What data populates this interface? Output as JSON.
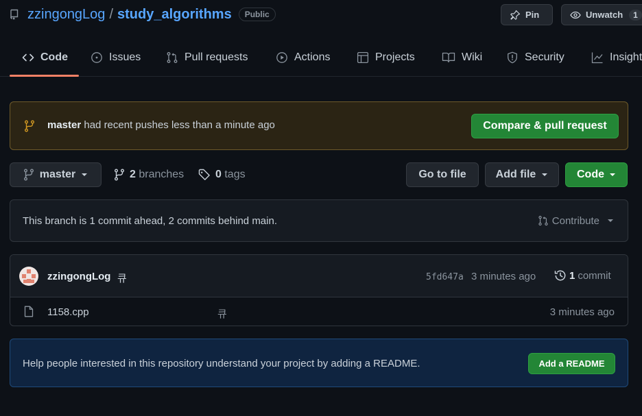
{
  "header": {
    "owner": "zzingongLog",
    "separator": "/",
    "repo_name": "study_algorithms",
    "visibility": "Public",
    "pin_label": "Pin",
    "watch_label": "Unwatch",
    "watch_count": "1"
  },
  "tabs": [
    {
      "label": "Code",
      "icon": "code-icon",
      "selected": true
    },
    {
      "label": "Issues",
      "icon": "issue-icon"
    },
    {
      "label": "Pull requests",
      "icon": "pull-request-icon"
    },
    {
      "label": "Actions",
      "icon": "play-icon"
    },
    {
      "label": "Projects",
      "icon": "table-icon"
    },
    {
      "label": "Wiki",
      "icon": "book-icon"
    },
    {
      "label": "Security",
      "icon": "shield-icon"
    },
    {
      "label": "Insights",
      "icon": "graph-icon"
    }
  ],
  "push_banner": {
    "branch": "master",
    "message": " had recent pushes less than a minute ago",
    "button_label": "Compare & pull request"
  },
  "branch_bar": {
    "current_branch": "master",
    "branches_count": "2",
    "branches_label": "branches",
    "tags_count": "0",
    "tags_label": "tags",
    "go_to_file": "Go to file",
    "add_file": "Add file",
    "code_button": "Code"
  },
  "branch_status": {
    "text": "This branch is 1 commit ahead, 2 commits behind main.",
    "contribute_label": "Contribute"
  },
  "commit": {
    "author": "zzingongLog",
    "message": "큐",
    "sha": "5fd647a",
    "time": "3 minutes ago",
    "count": "1",
    "count_label": "commit"
  },
  "files": [
    {
      "name": "1158.cpp",
      "message": "큐",
      "time": "3 minutes ago",
      "icon": "file-icon"
    }
  ],
  "readme_prompt": {
    "text": "Help people interested in this repository understand your project by adding a README.",
    "button_label": "Add a README"
  },
  "colors": {
    "background": "#0d1117",
    "link": "#58a6ff",
    "accent_underline": "#f78166",
    "green_button": "#238636",
    "banner_bg": "#2b2414",
    "readme_bg": "#0f2440"
  }
}
